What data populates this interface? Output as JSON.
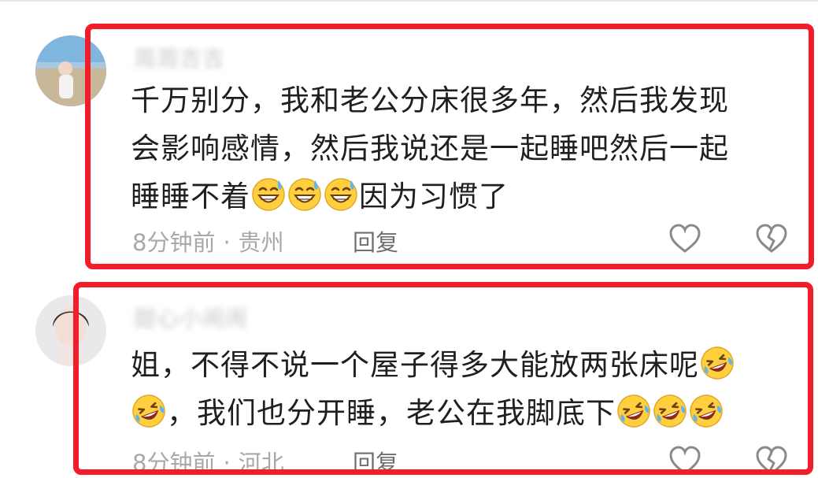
{
  "comments": [
    {
      "username": "周周吉吉",
      "lines": [
        [
          {
            "t": "text",
            "v": "千万别分，我和老公分床很多年，然后我发现"
          }
        ],
        [
          {
            "t": "text",
            "v": "会影响感情，然后我说还是一起睡吧然后一起"
          }
        ],
        [
          {
            "t": "text",
            "v": "睡睡不着"
          },
          {
            "t": "emoji",
            "v": "grin-sweat"
          },
          {
            "t": "emoji",
            "v": "grin-sweat"
          },
          {
            "t": "emoji",
            "v": "grin-sweat"
          },
          {
            "t": "text",
            "v": "因为习惯了"
          }
        ]
      ],
      "time": "8分钟前",
      "separator": "·",
      "location": "贵州",
      "reply_label": "回复"
    },
    {
      "username": "甜心小闹闹",
      "lines": [
        [
          {
            "t": "text",
            "v": "姐，不得不说一个屋子得多大能放两张床呢"
          },
          {
            "t": "emoji",
            "v": "rofl"
          }
        ],
        [
          {
            "t": "emoji",
            "v": "rofl"
          },
          {
            "t": "text",
            "v": "，我们也分开睡，老公在我脚底下"
          },
          {
            "t": "emoji",
            "v": "rofl"
          },
          {
            "t": "emoji",
            "v": "rofl"
          },
          {
            "t": "emoji",
            "v": "rofl"
          }
        ]
      ],
      "time": "8分钟前",
      "separator": "·",
      "location": "河北",
      "reply_label": "回复"
    }
  ],
  "icons": {
    "like": "heart-icon",
    "dislike": "broken-heart-icon"
  },
  "colors": {
    "highlight": "#f21d2b",
    "meta": "#a8a8a8",
    "text": "#1f1f1f"
  }
}
